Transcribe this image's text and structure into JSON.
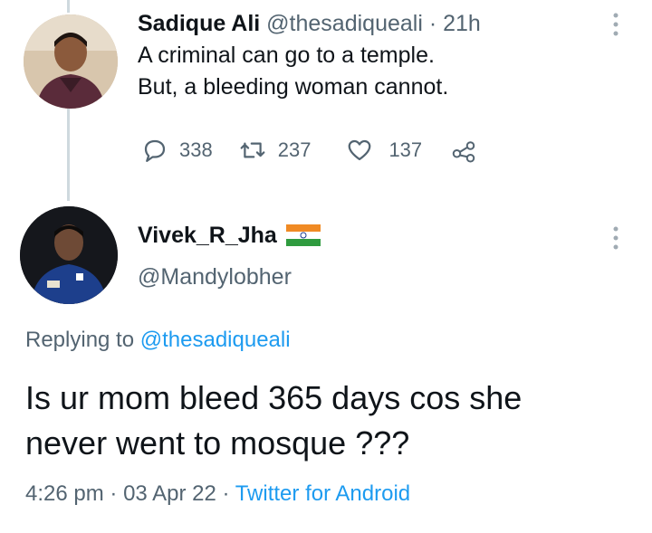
{
  "tweet1": {
    "display_name": "Sadique Ali",
    "handle": "@thesadiqueali",
    "separator": "·",
    "time": "21h",
    "text_line1": "A criminal can go to a temple.",
    "text_line2": "But, a bleeding woman cannot.",
    "replies": "338",
    "retweets": "237",
    "likes": "137"
  },
  "tweet2": {
    "display_name": "Vivek_R_Jha",
    "handle": "@Mandylobher",
    "replying_prefix": "Replying to",
    "replying_to": "@thesadiqueali",
    "text_line1": "Is ur mom bleed 365 days cos she",
    "text_line2": "never went to mosque ???",
    "time": "4:26 pm",
    "sep1": "·",
    "date": "03 Apr 22",
    "sep2": "·",
    "source": "Twitter for Android"
  },
  "colors": {
    "text": "#0f1419",
    "muted": "#536471",
    "link": "#1d9bf0",
    "thread_line": "#cfd9de"
  },
  "icons": [
    "more-icon",
    "reply-icon",
    "retweet-icon",
    "like-icon",
    "share-icon",
    "india-flag-icon"
  ]
}
